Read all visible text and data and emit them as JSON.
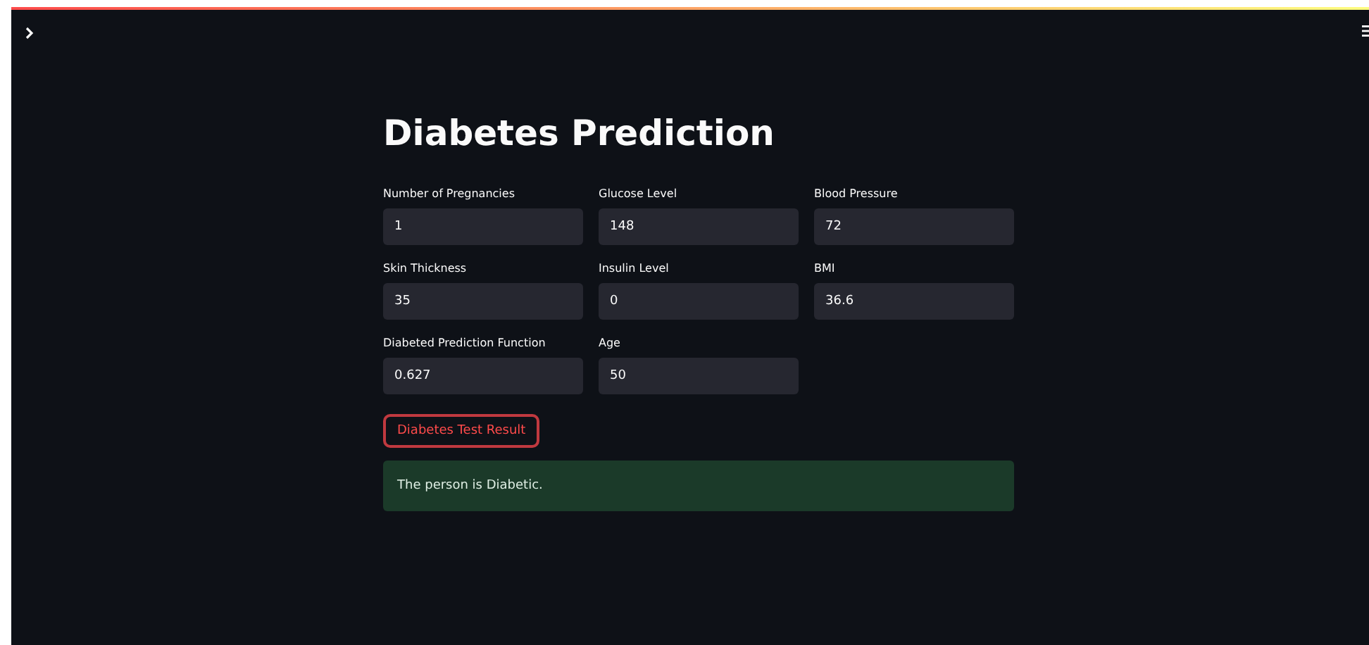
{
  "title": "Diabetes Prediction",
  "fields": [
    {
      "label": "Number of Pregnancies",
      "value": "1"
    },
    {
      "label": "Glucose Level",
      "value": "148"
    },
    {
      "label": "Blood Pressure",
      "value": "72"
    },
    {
      "label": "Skin Thickness",
      "value": "35"
    },
    {
      "label": "Insulin Level",
      "value": "0"
    },
    {
      "label": "BMI",
      "value": "36.6"
    },
    {
      "label": "Diabeted Prediction Function",
      "value": "0.627"
    },
    {
      "label": "Age",
      "value": "50"
    }
  ],
  "button": {
    "label": "Diabetes Test Result"
  },
  "result": {
    "kind": "success",
    "message": "The person is Diabetic."
  }
}
